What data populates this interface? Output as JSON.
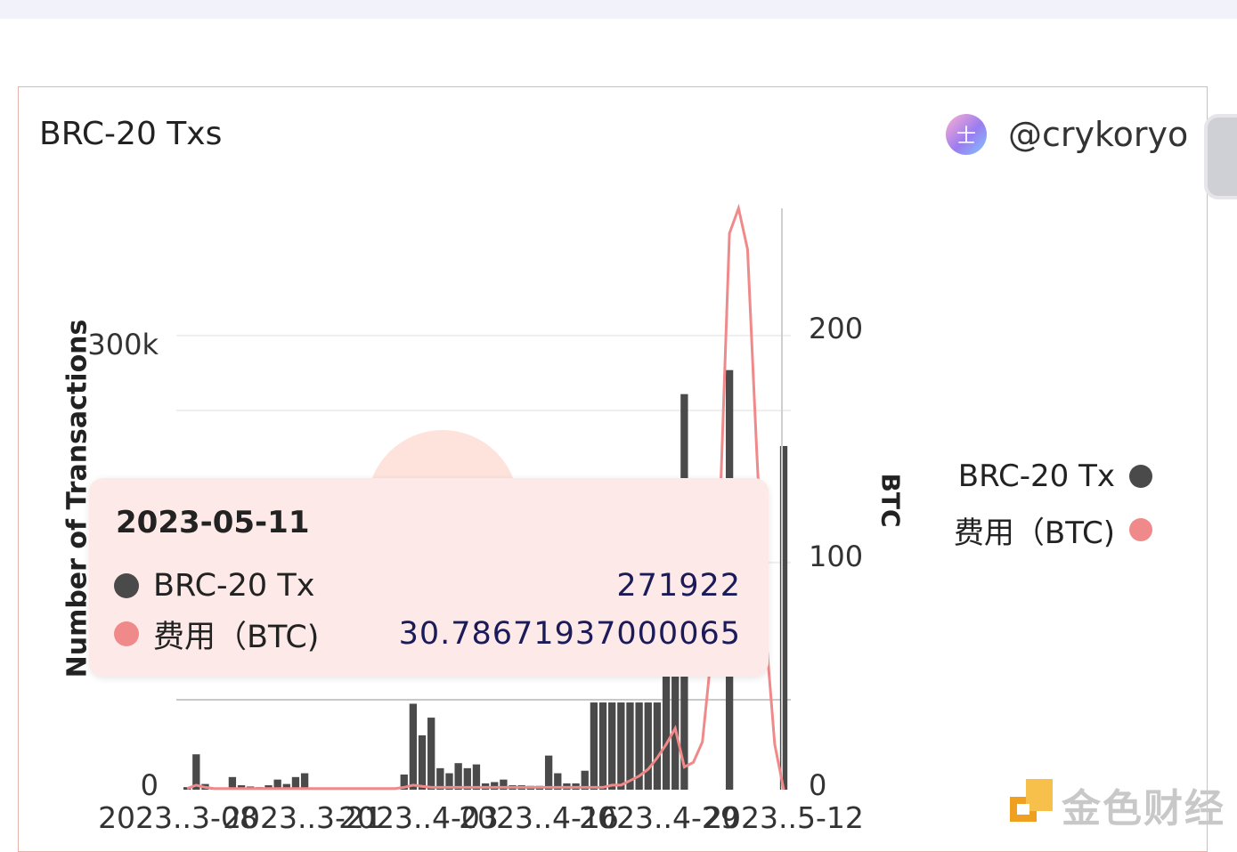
{
  "card": {
    "title": "BRC-20 Txs",
    "author": "@crykoryo",
    "avatar_glyph": "士"
  },
  "legend": [
    {
      "label": "BRC-20 Tx",
      "color": "#4a4a4a"
    },
    {
      "label": "费用（BTC)",
      "color": "#f08a8a"
    }
  ],
  "tooltip": {
    "date": "2023-05-11",
    "rows": [
      {
        "name": "BRC-20 Tx",
        "value": "271922",
        "color": "#4a4a4a"
      },
      {
        "name": "费用（BTC)",
        "value": "30.78671937000065",
        "color": "#f08a8a"
      }
    ]
  },
  "watermark": "金色财经",
  "chart_data": {
    "type": "bar+line",
    "title": "BRC-20 Txs",
    "ylabel": "Number of Transactions",
    "y2label": "BTC",
    "ylim": [
      0,
      460000
    ],
    "y2lim": [
      0,
      256
    ],
    "yticks": [
      "0",
      "300k"
    ],
    "y2ticks": [
      "0",
      "100",
      "200"
    ],
    "xticks": [
      "2023..3-08",
      "2023..3-21",
      "2023..4-03",
      "2023..4-16",
      "2023..4-29",
      "2023..5-12"
    ],
    "series": [
      {
        "name": "BRC-20 Tx",
        "kind": "bar",
        "values": [
          2000,
          28000,
          4500,
          1000,
          800,
          10000,
          3500,
          2500,
          2000,
          3500,
          8000,
          4500,
          10000,
          13000,
          0,
          0,
          0,
          0,
          0,
          0,
          0,
          0,
          0,
          0,
          12000,
          68000,
          43000,
          57000,
          17000,
          13000,
          21000,
          17000,
          20000,
          5000,
          6000,
          8000,
          3500,
          3500,
          3000,
          3000,
          27000,
          13000,
          5000,
          5000,
          15000,
          69000,
          69000,
          69000,
          69000,
          69000,
          69000,
          69000,
          69000,
          205000,
          226000,
          313000,
          0,
          0,
          0,
          0,
          332000,
          0,
          0,
          0,
          0,
          0,
          271922
        ]
      },
      {
        "name": "费用（BTC)",
        "kind": "line",
        "values": [
          0.5,
          2,
          1,
          0.5,
          0.5,
          0.5,
          0.5,
          0.5,
          0.5,
          0.5,
          0.5,
          0.5,
          0.5,
          0.5,
          0.5,
          0.5,
          0.5,
          0.5,
          0.5,
          0.5,
          0.5,
          0.5,
          0.5,
          0.5,
          1,
          2,
          1.5,
          1,
          1,
          1,
          1,
          1,
          1,
          1,
          1,
          1,
          1,
          1,
          1,
          1,
          1,
          1,
          1,
          1,
          1,
          1,
          1,
          2,
          2,
          4,
          6,
          9,
          14,
          20,
          27,
          10,
          12,
          21,
          60,
          130,
          245,
          256,
          238,
          150,
          70,
          20,
          0
        ]
      }
    ]
  }
}
